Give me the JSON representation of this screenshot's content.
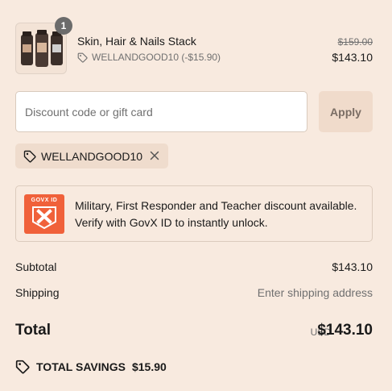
{
  "product": {
    "name": "Skin, Hair & Nails Stack",
    "quantity": "1",
    "discount_line": "WELLANDGOOD10 (-$15.90)",
    "original_price": "$159.00",
    "final_price": "$143.10"
  },
  "discount_form": {
    "placeholder": "Discount code or gift card",
    "value": "",
    "apply_label": "Apply"
  },
  "applied_code": {
    "code": "WELLANDGOOD10"
  },
  "govx": {
    "logo_text": "GOVX ID",
    "message": "Military, First Responder and Teacher discount available. Verify with GovX ID to instantly unlock."
  },
  "summary": {
    "subtotal_label": "Subtotal",
    "subtotal_value": "$143.10",
    "shipping_label": "Shipping",
    "shipping_value": "Enter shipping address",
    "total_label": "Total",
    "currency": "USD",
    "total_value": "$143.10",
    "savings_label": "TOTAL SAVINGS",
    "savings_value": "$15.90"
  },
  "colors": {
    "background": "#f8eadf",
    "govx_orange": "#f0613a",
    "apply_bg": "#f0dbcb",
    "tag_bg": "#efdccd"
  }
}
